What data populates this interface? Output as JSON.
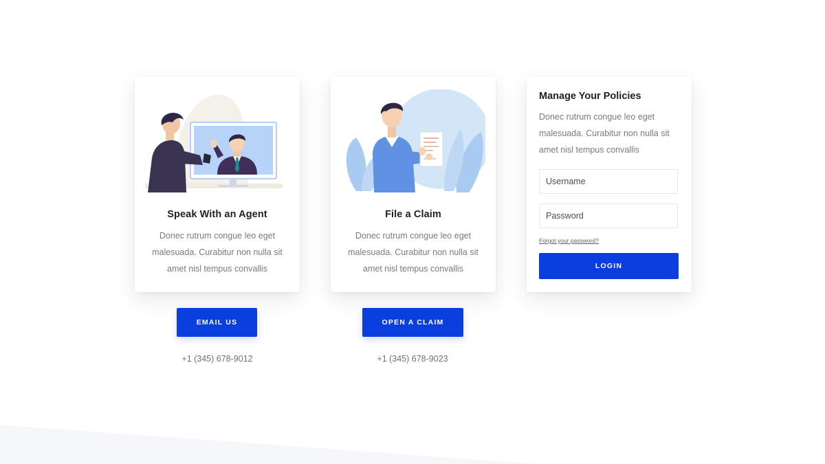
{
  "colors": {
    "accent": "#0b3ede",
    "background": "#ffffff",
    "wedge": "#f5f7fb",
    "body_text": "#777a80",
    "heading_text": "#222222"
  },
  "cards": {
    "agent": {
      "illustration": "video-call-agent-illustration",
      "title": "Speak With an Agent",
      "text": "Donec rutrum congue leo eget malesuada. Curabitur non nulla sit amet nisl tempus convallis",
      "button_label": "EMAIL US",
      "phone": "+1 (345) 678-9012"
    },
    "claim": {
      "illustration": "person-holding-document-illustration",
      "title": "File a Claim",
      "text": "Donec rutrum congue leo eget malesuada. Curabitur non nulla sit amet nisl tempus convallis",
      "button_label": "OPEN A CLAIM",
      "phone": "+1 (345) 678-9023"
    }
  },
  "login": {
    "title": "Manage Your Policies",
    "text": "Donec rutrum congue leo eget malesuada. Curabitur non nulla sit amet nisl tempus convallis",
    "username_placeholder": "Username",
    "password_placeholder": "Password",
    "forgot_label": "Forgot your password?",
    "button_label": "LOGIN"
  }
}
